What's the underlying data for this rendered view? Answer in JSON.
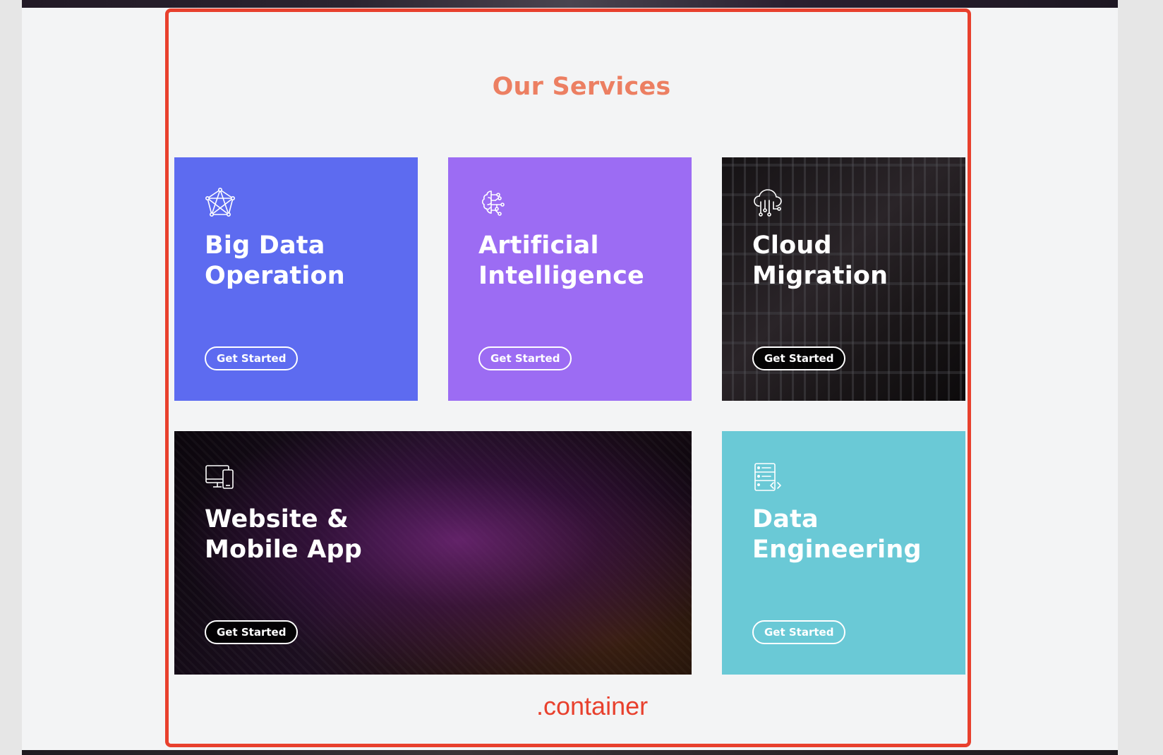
{
  "section": {
    "title": "Our Services"
  },
  "services": [
    {
      "title_line1": "Big Data",
      "title_line2": "Operation",
      "icon": "network-polygon-icon",
      "cta": "Get Started",
      "bg_color": "#5d6bf0"
    },
    {
      "title_line1": "Artificial",
      "title_line2": "Intelligence",
      "icon": "brain-circuit-icon",
      "cta": "Get Started",
      "bg_color": "#9c6cf3"
    },
    {
      "title_line1": "Cloud",
      "title_line2": "Migration",
      "icon": "cloud-circuit-icon",
      "cta": "Get Started",
      "bg_image": "server-rack-photo"
    },
    {
      "title_line1": "Website &",
      "title_line2": "Mobile App",
      "icon": "devices-icon",
      "cta": "Get Started",
      "bg_image": "circuit-board-photo"
    },
    {
      "title_line1": "Data",
      "title_line2": "Engineering",
      "icon": "server-code-icon",
      "cta": "Get Started",
      "bg_color": "#6ac9d6"
    }
  ],
  "devtools": {
    "container_label": ".container",
    "highlight_color": "#e8402d"
  },
  "colors": {
    "title_accent": "#ec7f62",
    "page_bg": "#f3f4f5"
  }
}
